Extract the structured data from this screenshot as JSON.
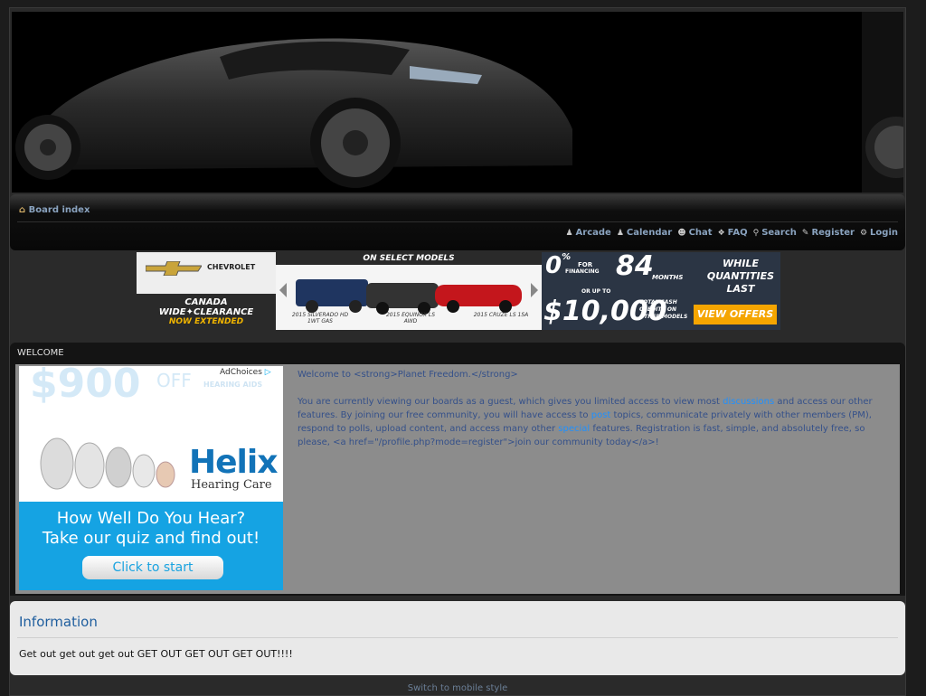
{
  "navbar": {
    "breadcrumb": "Board index",
    "links": [
      {
        "label": "Arcade",
        "icon": "arcade-icon"
      },
      {
        "label": "Calendar",
        "icon": "calendar-icon"
      },
      {
        "label": "Chat",
        "icon": "chat-icon"
      },
      {
        "label": "FAQ",
        "icon": "faq-icon"
      },
      {
        "label": "Search",
        "icon": "search-icon"
      },
      {
        "label": "Register",
        "icon": "register-icon"
      },
      {
        "label": "Login",
        "icon": "login-icon"
      }
    ]
  },
  "ad_banner": {
    "brand": "CHEVROLET",
    "tagline": "CANADA WIDE✦CLEARANCE",
    "extended": "NOW EXTENDED",
    "headline": "ON SELECT MODELS",
    "models": [
      "2015 SILVERADO HD 1WT GAS",
      "2015 EQUINOX LS AWD",
      "2015 CRUZE LS 1SA"
    ],
    "rate": "0",
    "rate_sup": "%",
    "financing": "FINANCING",
    "for": "FOR",
    "months_num": "84",
    "months": "MONTHS",
    "up_to": "OR UP TO",
    "cash_amount": "$10,000",
    "cash_note": "TOTAL CASH CREDITS ON OTHER MODELS",
    "while": "WHILE QUANTITIES LAST",
    "cta": "VIEW OFFERS"
  },
  "welcome": {
    "title": "WELCOME",
    "para1": "Welcome to <strong>Planet Freedom.</strong>",
    "para2_a": "You are currently viewing our boards as a guest, which gives you limited access to view most ",
    "para2_link1": "discussions",
    "para2_b": " and access our other features. By joining our free community, you will have access to ",
    "para2_link2": "post",
    "para2_c": " topics, communicate privately with other members (PM), respond to polls, upload content, and access many other ",
    "para2_link3": "special",
    "para2_d": " features. Registration is fast, simple, and absolutely free, so please, <a href=\"/profile.php?mode=register\">join our community today</a>!"
  },
  "side_ad": {
    "big_price": "$900",
    "off": "OFF",
    "hearing_aids": "HEARING AIDS",
    "adchoices": "AdChoices",
    "brand": "Helix",
    "brand_sub": "Hearing Care",
    "question": "How Well Do You Hear?",
    "cta_line": "Take our quiz and find out!",
    "button": "Click to start"
  },
  "information": {
    "title": "Information",
    "body": "Get out get out get out GET OUT GET OUT GET OUT!!!!"
  },
  "footer": {
    "mobile_link": "Switch to mobile style"
  }
}
